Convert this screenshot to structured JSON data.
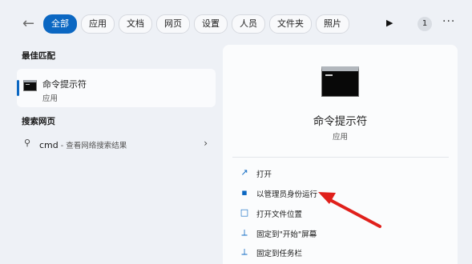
{
  "header": {
    "back_icon": "back-arrow-icon",
    "tabs": [
      {
        "label": "全部",
        "active": true
      },
      {
        "label": "应用"
      },
      {
        "label": "文档"
      },
      {
        "label": "网页"
      },
      {
        "label": "设置"
      },
      {
        "label": "人员"
      },
      {
        "label": "文件夹"
      },
      {
        "label": "照片"
      }
    ],
    "badge": "1"
  },
  "left": {
    "best_match_title": "最佳匹配",
    "best_match": {
      "name": "命令提示符",
      "type": "应用"
    },
    "web_title": "搜索网页",
    "web_result": {
      "query": "cmd",
      "hint": " - 查看网络搜索结果"
    }
  },
  "preview": {
    "name": "命令提示符",
    "type": "应用",
    "actions": [
      {
        "label": "打开",
        "icon": "open-external-icon"
      },
      {
        "label": "以管理员身份运行",
        "icon": "shield-admin-icon"
      },
      {
        "label": "打开文件位置",
        "icon": "folder-icon"
      },
      {
        "label": "固定到\"开始\"屏幕",
        "icon": "pin-icon"
      },
      {
        "label": "固定到任务栏",
        "icon": "pin-icon"
      }
    ]
  },
  "colors": {
    "accent": "#0b67c2",
    "annotation_arrow": "#e0201b"
  }
}
